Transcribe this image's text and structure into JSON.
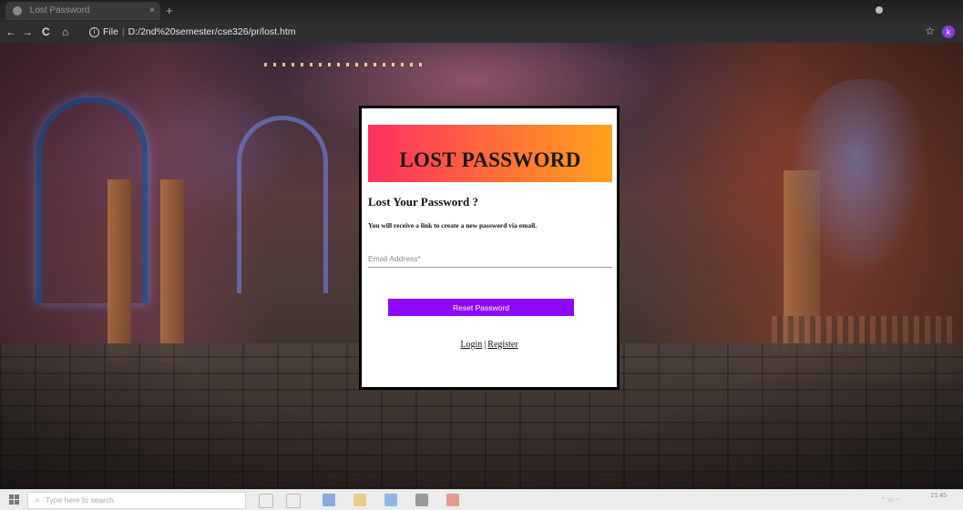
{
  "browser": {
    "tab_title": "Lost Password",
    "new_tab": "+",
    "tab_close": "×",
    "nav_back": "←",
    "nav_forward": "→",
    "nav_reload": "C",
    "nav_home": "⌂",
    "url_scheme_label": "File",
    "url": "D:/2nd%20semester/cse326/pr/lost.htm",
    "star": "☆",
    "profile_initial": "k"
  },
  "card": {
    "banner_title": "LOST PASSWORD",
    "subheading": "Lost Your Password ?",
    "instruction": "You will receive a link to create a new password via email.",
    "email_placeholder": "Email Address*",
    "email_value": "",
    "reset_button_label": "Reset Password",
    "login_link": "Login",
    "separator": "|",
    "register_link": "Register"
  },
  "taskbar": {
    "search_placeholder": "Type here to search",
    "clock_time": "21:45"
  },
  "colors": {
    "banner_gradient_start": "#ff2f62",
    "banner_gradient_end": "#ffa21d",
    "reset_button_bg": "#8f08ff",
    "profile_bg": "#8a3bd9"
  }
}
